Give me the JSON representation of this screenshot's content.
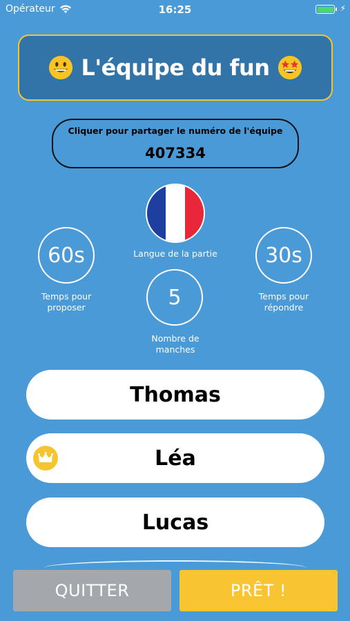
{
  "status_bar": {
    "carrier": "Opérateur",
    "time": "16:25"
  },
  "team": {
    "name": "L'équipe du fun",
    "left_emoji": "grinning-face-icon",
    "right_emoji": "star-struck-icon"
  },
  "share": {
    "label": "Cliquer pour partager le numéro de l'équipe",
    "number": "407334"
  },
  "settings": {
    "language_label": "Langue de la partie",
    "propose_time": "60s",
    "propose_label_line1": "Temps pour",
    "propose_label_line2": "proposer",
    "answer_time": "30s",
    "answer_label_line1": "Temps pour",
    "answer_label_line2": "répondre",
    "rounds": "5",
    "rounds_label_line1": "Nombre de",
    "rounds_label_line2": "manches"
  },
  "players": [
    {
      "name": "Thomas",
      "is_host": false
    },
    {
      "name": "Léa",
      "is_host": true
    },
    {
      "name": "Lucas",
      "is_host": false
    }
  ],
  "buttons": {
    "quit": "QUITTER",
    "ready": "PRÊT !"
  },
  "colors": {
    "background": "#4a9ad8",
    "title_box": "#3274a8",
    "accent": "#f5c530",
    "quit": "#a4a7ab",
    "ready": "#f8c432"
  }
}
